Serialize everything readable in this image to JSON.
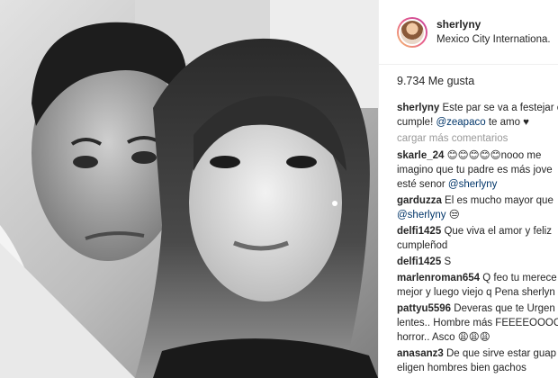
{
  "post": {
    "username": "sherlyny",
    "location": "Mexico City Internationa...",
    "likes": "9.734 Me gusta",
    "caption": {
      "user": "sherlyny",
      "text_line1": "Este par se va a festejar e",
      "text_line2_pre": "cumple! ",
      "mention": "@zeapaco",
      "text_line2_post": " te amo ♥"
    },
    "load_more": "cargar más comentarios"
  },
  "comments": [
    {
      "user": "skarle_24",
      "lines": [
        "😊😊😊😊😊nooo me",
        "imagino que tu padre es más jove",
        "esté senor "
      ],
      "mention": "@sherlyny"
    },
    {
      "user": "garduzza",
      "lines": [
        "El es mucho mayor que"
      ],
      "mention_line": "@sherlyny",
      "after": " 😒"
    },
    {
      "user": "delfi1425",
      "lines": [
        "Que viva el amor y feliz",
        "cumpleñod"
      ]
    },
    {
      "user": "delfi1425",
      "lines": [
        "S"
      ]
    },
    {
      "user": "marlenroman654",
      "lines": [
        "Q feo tu merece",
        "mejor y luego viejo q Pena sherlyn"
      ]
    },
    {
      "user": "pattyu5596",
      "lines": [
        "Deveras que te Urgen",
        "lentes.. Hombre más FEEEEOOOC",
        "horror.. Asco 😩😩😩"
      ]
    },
    {
      "user": "anasanz3",
      "lines": [
        "De que sirve estar guap",
        "eligen hombres bien gachos"
      ]
    }
  ]
}
